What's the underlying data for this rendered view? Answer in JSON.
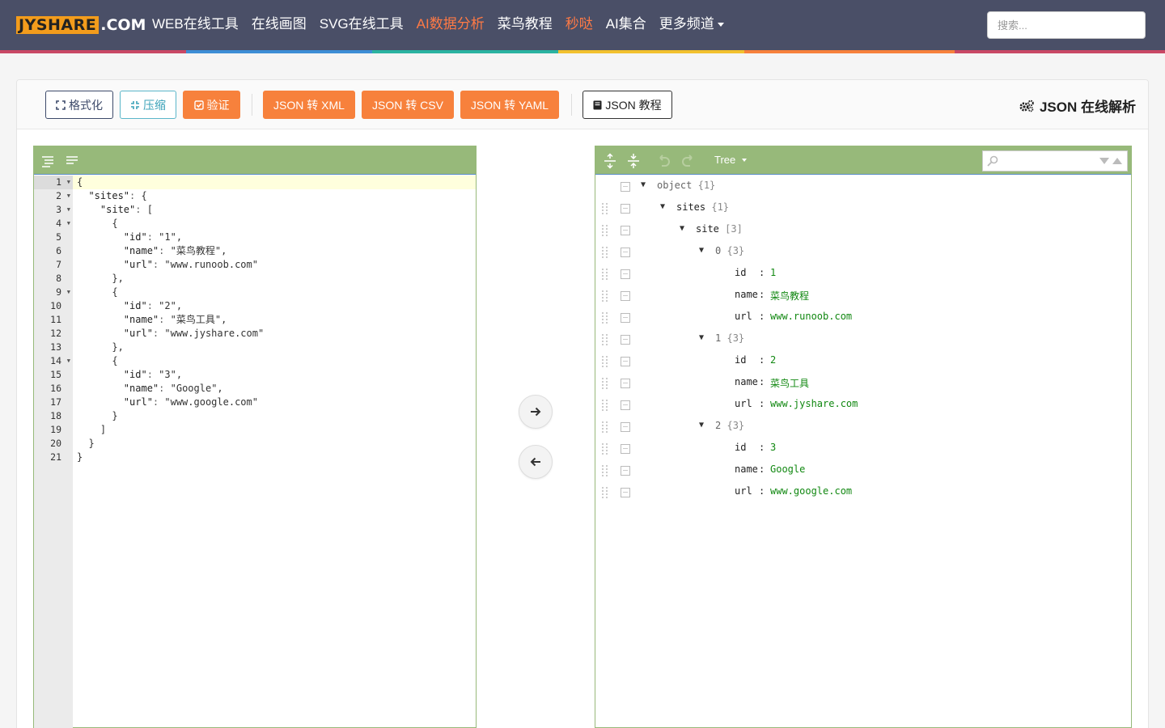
{
  "header": {
    "logo_main": "JYSHARE",
    "logo_suffix": ".COM",
    "nav": [
      {
        "label": "WEB在线工具",
        "highlight": false
      },
      {
        "label": "在线画图",
        "highlight": false
      },
      {
        "label": "SVG在线工具",
        "highlight": false
      },
      {
        "label": "AI数据分析",
        "highlight": true
      },
      {
        "label": "菜鸟教程",
        "highlight": false
      },
      {
        "label": "秒哒",
        "highlight": true
      },
      {
        "label": "AI集合",
        "highlight": false
      },
      {
        "label": "更多频道",
        "highlight": false,
        "dropdown": true
      }
    ],
    "search_placeholder": "搜索..."
  },
  "toolbar": {
    "format_label": "格式化",
    "compress_label": "压缩",
    "validate_label": "验证",
    "to_xml_label": "JSON 转 XML",
    "to_csv_label": "JSON 转 CSV",
    "to_yaml_label": "JSON 转 YAML",
    "tutorial_label": "JSON 教程",
    "title": "JSON 在线解析"
  },
  "editor": {
    "lines": [
      "{",
      "  \"sites\": {",
      "    \"site\": [",
      "      {",
      "        \"id\": \"1\",",
      "        \"name\": \"菜鸟教程\",",
      "        \"url\": \"www.runoob.com\"",
      "      },",
      "      {",
      "        \"id\": \"2\",",
      "        \"name\": \"菜鸟工具\",",
      "        \"url\": \"www.jyshare.com\"",
      "      },",
      "      {",
      "        \"id\": \"3\",",
      "        \"name\": \"Google\",",
      "        \"url\": \"www.google.com\"",
      "      }",
      "    ]",
      "  }",
      "}"
    ],
    "foldable_lines": [
      1,
      2,
      3,
      4,
      9,
      14
    ],
    "active_line": 1
  },
  "tree": {
    "mode_label": "Tree",
    "rows": [
      {
        "key": "object",
        "count": "{1}",
        "type": "obj"
      },
      {
        "key": "sites",
        "count": "{1}",
        "type": "obj"
      },
      {
        "key": "site",
        "count": "[3]",
        "type": "arr"
      },
      {
        "key": "0",
        "count": "{3}",
        "type": "idx"
      },
      {
        "key": "id",
        "value": "1",
        "type": "val"
      },
      {
        "key": "name",
        "value": "菜鸟教程",
        "type": "val"
      },
      {
        "key": "url",
        "value": "www.runoob.com",
        "type": "val"
      },
      {
        "key": "1",
        "count": "{3}",
        "type": "idx"
      },
      {
        "key": "id",
        "value": "2",
        "type": "val"
      },
      {
        "key": "name",
        "value": "菜鸟工具",
        "type": "val"
      },
      {
        "key": "url",
        "value": "www.jyshare.com",
        "type": "val"
      },
      {
        "key": "2",
        "count": "{3}",
        "type": "idx"
      },
      {
        "key": "id",
        "value": "3",
        "type": "val"
      },
      {
        "key": "name",
        "value": "Google",
        "type": "val"
      },
      {
        "key": "url",
        "value": "www.google.com",
        "type": "val"
      }
    ]
  },
  "colors": {
    "header_bg": "#4a4f67",
    "accent_orange": "#f7813c",
    "panel_green": "#97b97a",
    "string_green": "#1a8c1a"
  }
}
